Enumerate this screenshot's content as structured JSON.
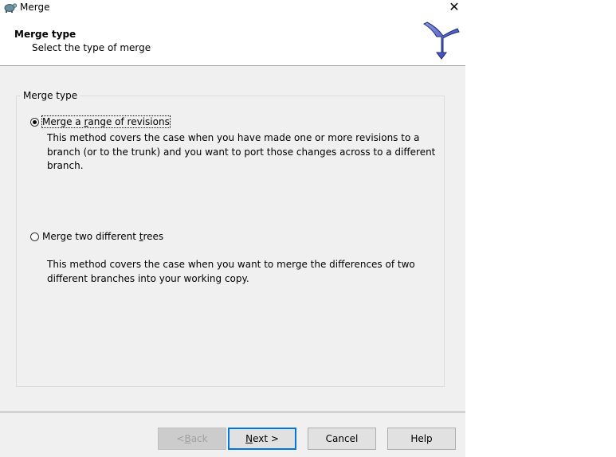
{
  "window": {
    "title": "Merge",
    "close_symbol": "✕"
  },
  "header": {
    "title": "Merge type",
    "subtitle": "Select the type of merge"
  },
  "group": {
    "label": "Merge type"
  },
  "options": [
    {
      "label_pre": "Merge a ",
      "label_key": "r",
      "label_post": "ange of revisions",
      "checked": true,
      "description": "This method covers the case when you have made one or more revisions to a branch (or to the trunk) and you want to port those changes across to a different branch."
    },
    {
      "label_pre": "Merge two different ",
      "label_key": "t",
      "label_post": "rees",
      "checked": false,
      "description": "This method covers the case when you want to merge the differences of two different branches into your working copy."
    }
  ],
  "buttons": {
    "back": {
      "pre": "< ",
      "key": "B",
      "post": "ack"
    },
    "next": {
      "pre": "",
      "key": "N",
      "post": "ext >"
    },
    "cancel": "Cancel",
    "help": "Help"
  }
}
